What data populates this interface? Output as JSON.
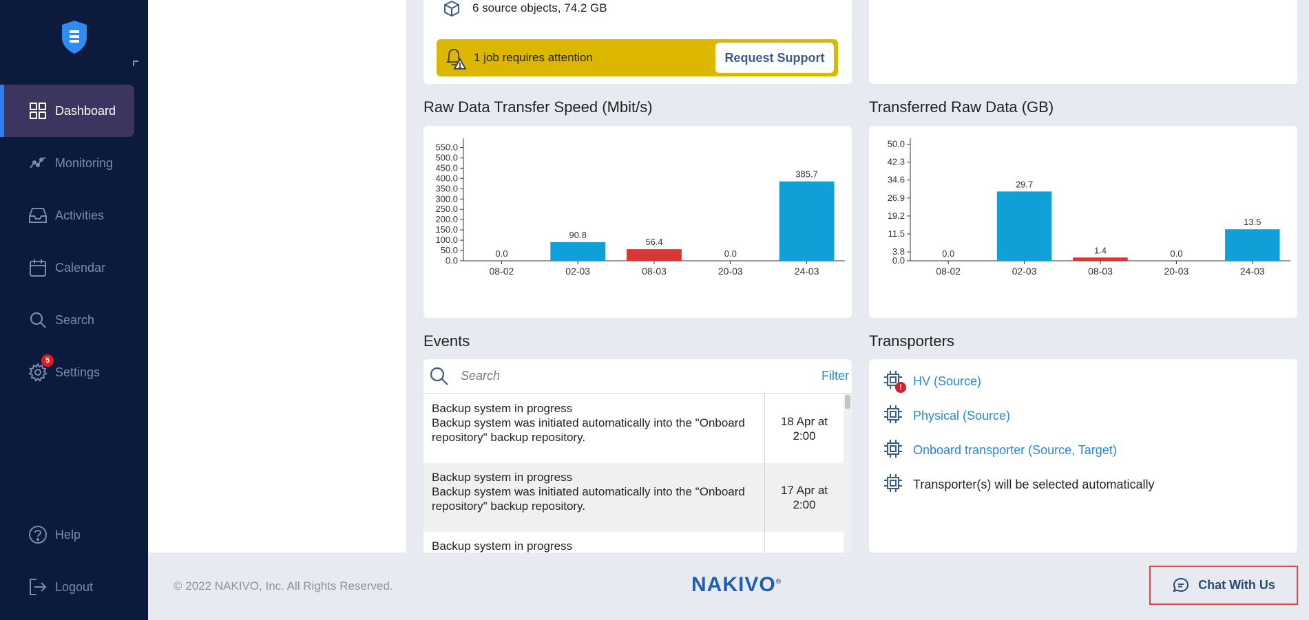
{
  "sidebar": {
    "items": [
      {
        "label": "Dashboard",
        "icon": "dashboard-icon",
        "active": true
      },
      {
        "label": "Monitoring",
        "icon": "monitoring-icon"
      },
      {
        "label": "Activities",
        "icon": "inbox-icon"
      },
      {
        "label": "Calendar",
        "icon": "calendar-icon"
      },
      {
        "label": "Search",
        "icon": "search-icon"
      },
      {
        "label": "Settings",
        "icon": "gear-icon",
        "badge": "5"
      },
      {
        "label": "Help",
        "icon": "help-icon"
      },
      {
        "label": "Logout",
        "icon": "logout-icon"
      }
    ]
  },
  "summary": {
    "source_objects": "6 source objects, 74.2 GB",
    "attention_text": "1 job requires attention",
    "request_support": "Request Support"
  },
  "speed_chart": {
    "title": "Raw Data Transfer Speed (Mbit/s)"
  },
  "data_chart": {
    "title": "Transferred Raw Data (GB)"
  },
  "chart_data": [
    {
      "type": "bar",
      "title": "Raw Data Transfer Speed (Mbit/s)",
      "categories": [
        "08-02",
        "02-03",
        "08-03",
        "20-03",
        "24-03"
      ],
      "values": [
        0.0,
        90.8,
        56.4,
        0.0,
        385.7
      ],
      "value_labels": [
        "0.0",
        "90.8",
        "56.4",
        "0.0",
        "385.7"
      ],
      "bar_colors": [
        "#0ea0d6",
        "#0ea0d6",
        "#d93636",
        "#0ea0d6",
        "#0ea0d6"
      ],
      "yticks": [
        "0.0",
        "50.0",
        "100.0",
        "150.0",
        "200.0",
        "250.0",
        "300.0",
        "350.0",
        "400.0",
        "450.0",
        "500.0",
        "550.0"
      ],
      "ytick_values": [
        0,
        50,
        100,
        150,
        200,
        250,
        300,
        350,
        400,
        450,
        500,
        550
      ],
      "ylim": [
        0,
        595
      ]
    },
    {
      "type": "bar",
      "title": "Transferred Raw Data (GB)",
      "categories": [
        "08-02",
        "02-03",
        "08-03",
        "20-03",
        "24-03"
      ],
      "values": [
        0.0,
        29.7,
        1.4,
        0.0,
        13.5
      ],
      "value_labels": [
        "0.0",
        "29.7",
        "1.4",
        "0.0",
        "13.5"
      ],
      "bar_colors": [
        "#0ea0d6",
        "#0ea0d6",
        "#d93636",
        "#0ea0d6",
        "#0ea0d6"
      ],
      "yticks": [
        "0.0",
        "3.8",
        "11.5",
        "19.2",
        "26.9",
        "34.6",
        "42.3",
        "50.0"
      ],
      "ytick_values": [
        0,
        3.8,
        11.5,
        19.2,
        26.9,
        34.6,
        42.3,
        50.0
      ],
      "ylim": [
        0,
        52.5
      ]
    }
  ],
  "events": {
    "title": "Events",
    "search_placeholder": "Search",
    "filter_label": "Filter",
    "rows": [
      {
        "title": "Backup system in progress",
        "detail": "Backup system was initiated automatically into the \"Onboard repository\" backup repository.",
        "date": "18 Apr at 2:00"
      },
      {
        "title": "Backup system in progress",
        "detail": "Backup system was initiated automatically into the \"Onboard repository\" backup repository.",
        "date": "17 Apr at 2:00"
      },
      {
        "title": "Backup system in progress",
        "detail": "",
        "date": ""
      }
    ]
  },
  "transporters": {
    "title": "Transporters",
    "items": [
      {
        "label": "HV (Source)",
        "link": true,
        "warning": true
      },
      {
        "label": "Physical (Source)",
        "link": true
      },
      {
        "label": "Onboard transporter (Source, Target)",
        "link": true
      },
      {
        "label": "Transporter(s) will be selected automatically",
        "link": false
      }
    ]
  },
  "footer": {
    "copyright": "© 2022 NAKIVO, Inc. All Rights Reserved.",
    "brand": "NAKIVO",
    "brand_mark": "®",
    "chat_label": "Chat With Us"
  },
  "colors": {
    "sidebar_bg": "#0c1b3d",
    "accent": "#2b86d9",
    "bar_blue": "#0ea0d6",
    "bar_red": "#d93636",
    "attention": "#dcb700"
  }
}
